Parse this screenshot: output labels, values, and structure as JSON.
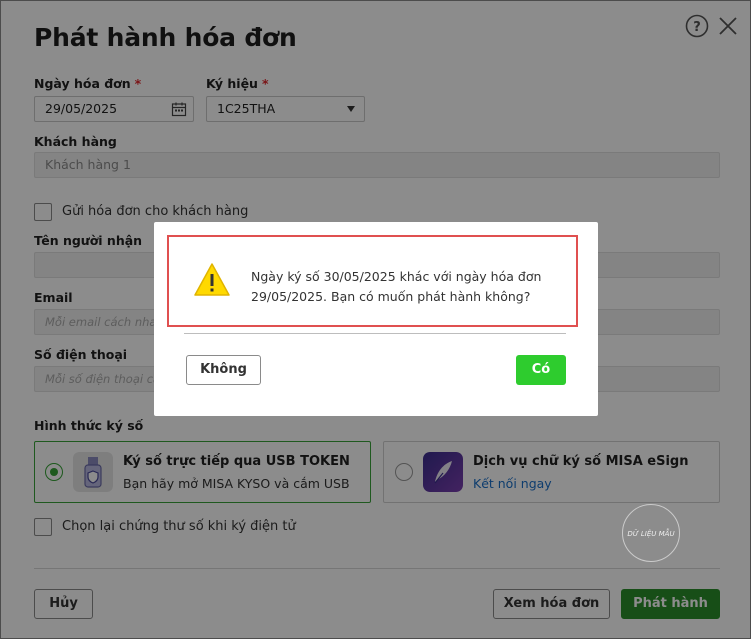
{
  "dialog": {
    "title": "Phát hành hóa đơn"
  },
  "form": {
    "invoice_date_label": "Ngày hóa đơn",
    "invoice_date_value": "29/05/2025",
    "symbol_label": "Ký hiệu",
    "symbol_value": "1C25THA",
    "required_mark": "*",
    "customer_label": "Khách hàng",
    "customer_value": "Khách hàng 1",
    "send_checkbox_label": "Gửi hóa đơn cho khách hàng",
    "recipient_label": "Tên người nhận",
    "email_label": "Email",
    "email_placeholder": "Mỗi email cách nhau",
    "phone_label": "Số điện thoại",
    "phone_placeholder": "Mỗi số điện thoại cá",
    "sign_method_label": "Hình thức ký số",
    "option_usb_title": "Ký số trực tiếp qua USB TOKEN",
    "option_usb_sub": "Bạn hãy mở MISA KYSO và cắm USB",
    "option_esign_title": "Dịch vụ chữ ký số MISA eSign",
    "option_esign_link": "Kết nối ngay",
    "reselect_cert_label": "Chọn lại chứng thư số khi ký điện tử",
    "watermark_text": "DỮ LIỆU MẪU"
  },
  "footer": {
    "cancel_label": "Hủy",
    "view_label": "Xem hóa đơn",
    "publish_label": "Phát hành"
  },
  "confirm": {
    "message_line1": "Ngày ký số 30/05/2025 khác với ngày hóa đơn",
    "message_line2": "29/05/2025. Bạn có muốn phát hành không?",
    "no_label": "Không",
    "yes_label": "Có"
  },
  "colors": {
    "primary_green": "#2b8f2b",
    "yes_green": "#2ecc2e",
    "required_red": "#e0262b",
    "alert_border": "#e05050",
    "link_blue": "#1a6fc9"
  },
  "icons": [
    "help-icon",
    "close-icon",
    "calendar-icon",
    "usb-token-icon",
    "misa-esign-icon",
    "warning-icon"
  ]
}
